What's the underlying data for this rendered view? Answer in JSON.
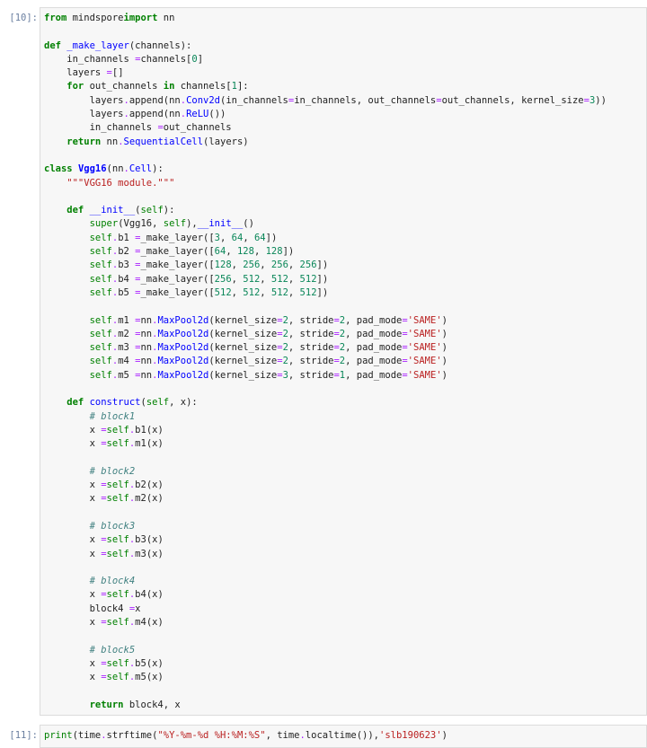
{
  "cells": [
    {
      "prompt": "[10]:",
      "lines": [
        [
          [
            "kw",
            "from"
          ],
          [
            "",
            "mindspore"
          ],
          [
            "kw",
            "import"
          ],
          [
            "",
            "nn"
          ]
        ],
        [],
        [
          [
            "kw",
            "def"
          ],
          [
            "fn",
            "_make_layer"
          ],
          [
            "",
            "(channels):"
          ]
        ],
        [
          [
            "",
            "    in_channels "
          ],
          [
            "op",
            "="
          ],
          [
            "",
            "channels["
          ],
          [
            "num",
            "0"
          ],
          [
            "",
            "]"
          ]
        ],
        [
          [
            "",
            "    layers "
          ],
          [
            "op",
            "="
          ],
          [
            "",
            "[]"
          ]
        ],
        [
          [
            "kw",
            "    for"
          ],
          [
            "",
            "out_channels "
          ],
          [
            "kw",
            "in"
          ],
          [
            "",
            "channels["
          ],
          [
            "num",
            "1"
          ],
          [
            "",
            "]:"
          ]
        ],
        [
          [
            "",
            "        layers"
          ],
          [
            "op",
            "."
          ],
          [
            "",
            "append(nn"
          ],
          [
            "op",
            "."
          ],
          [
            "fn",
            "Conv2d"
          ],
          [
            "",
            "(in_channels"
          ],
          [
            "op",
            "="
          ],
          [
            "",
            "in_channels, out_channels"
          ],
          [
            "op",
            "="
          ],
          [
            "",
            "out_channels, kernel_size"
          ],
          [
            "op",
            "="
          ],
          [
            "num",
            "3"
          ],
          [
            "",
            "))"
          ]
        ],
        [
          [
            "",
            "        layers"
          ],
          [
            "op",
            "."
          ],
          [
            "",
            "append(nn"
          ],
          [
            "op",
            "."
          ],
          [
            "fn",
            "ReLU"
          ],
          [
            "",
            "())"
          ]
        ],
        [
          [
            "",
            "        in_channels "
          ],
          [
            "op",
            "="
          ],
          [
            "",
            "out_channels"
          ]
        ],
        [
          [
            "kw",
            "    return"
          ],
          [
            "",
            "nn"
          ],
          [
            "op",
            "."
          ],
          [
            "fn",
            "SequentialCell"
          ],
          [
            "",
            "(layers)"
          ]
        ],
        [],
        [
          [
            "kw",
            "class"
          ],
          [
            "cls",
            "Vgg16"
          ],
          [
            "",
            "(nn"
          ],
          [
            "op",
            "."
          ],
          [
            "fn",
            "Cell"
          ],
          [
            "",
            "):"
          ]
        ],
        [
          [
            "str",
            "    \"\"\"VGG16 module.\"\"\""
          ]
        ],
        [],
        [
          [
            "kw",
            "    def"
          ],
          [
            "fn",
            "__init__"
          ],
          [
            "",
            "("
          ],
          [
            "self",
            "self"
          ],
          [
            "",
            "):"
          ]
        ],
        [
          [
            "builtin",
            "        super"
          ],
          [
            "",
            "(Vgg16, "
          ],
          [
            "self",
            "self"
          ],
          [
            "",
            "),"
          ],
          [
            "fn",
            "__init__"
          ],
          [
            "",
            "()"
          ]
        ],
        [
          [
            "self",
            "        self"
          ],
          [
            "op",
            "."
          ],
          [
            "",
            "b1 "
          ],
          [
            "op",
            "="
          ],
          [
            "",
            "_make_layer(["
          ],
          [
            "num",
            "3"
          ],
          [
            "",
            ", "
          ],
          [
            "num",
            "64"
          ],
          [
            "",
            ", "
          ],
          [
            "num",
            "64"
          ],
          [
            "",
            "])"
          ]
        ],
        [
          [
            "self",
            "        self"
          ],
          [
            "op",
            "."
          ],
          [
            "",
            "b2 "
          ],
          [
            "op",
            "="
          ],
          [
            "",
            "_make_layer(["
          ],
          [
            "num",
            "64"
          ],
          [
            "",
            ", "
          ],
          [
            "num",
            "128"
          ],
          [
            "",
            ", "
          ],
          [
            "num",
            "128"
          ],
          [
            "",
            "])"
          ]
        ],
        [
          [
            "self",
            "        self"
          ],
          [
            "op",
            "."
          ],
          [
            "",
            "b3 "
          ],
          [
            "op",
            "="
          ],
          [
            "",
            "_make_layer(["
          ],
          [
            "num",
            "128"
          ],
          [
            "",
            ", "
          ],
          [
            "num",
            "256"
          ],
          [
            "",
            ", "
          ],
          [
            "num",
            "256"
          ],
          [
            "",
            ", "
          ],
          [
            "num",
            "256"
          ],
          [
            "",
            "])"
          ]
        ],
        [
          [
            "self",
            "        self"
          ],
          [
            "op",
            "."
          ],
          [
            "",
            "b4 "
          ],
          [
            "op",
            "="
          ],
          [
            "",
            "_make_layer(["
          ],
          [
            "num",
            "256"
          ],
          [
            "",
            ", "
          ],
          [
            "num",
            "512"
          ],
          [
            "",
            ", "
          ],
          [
            "num",
            "512"
          ],
          [
            "",
            ", "
          ],
          [
            "num",
            "512"
          ],
          [
            "",
            "])"
          ]
        ],
        [
          [
            "self",
            "        self"
          ],
          [
            "op",
            "."
          ],
          [
            "",
            "b5 "
          ],
          [
            "op",
            "="
          ],
          [
            "",
            "_make_layer(["
          ],
          [
            "num",
            "512"
          ],
          [
            "",
            ", "
          ],
          [
            "num",
            "512"
          ],
          [
            "",
            ", "
          ],
          [
            "num",
            "512"
          ],
          [
            "",
            ", "
          ],
          [
            "num",
            "512"
          ],
          [
            "",
            "])"
          ]
        ],
        [],
        [
          [
            "self",
            "        self"
          ],
          [
            "op",
            "."
          ],
          [
            "",
            "m1 "
          ],
          [
            "op",
            "="
          ],
          [
            "",
            "nn"
          ],
          [
            "op",
            "."
          ],
          [
            "fn",
            "MaxPool2d"
          ],
          [
            "",
            "(kernel_size"
          ],
          [
            "op",
            "="
          ],
          [
            "num",
            "2"
          ],
          [
            "",
            ", stride"
          ],
          [
            "op",
            "="
          ],
          [
            "num",
            "2"
          ],
          [
            "",
            ", pad_mode"
          ],
          [
            "op",
            "="
          ],
          [
            "str",
            "'SAME'"
          ],
          [
            "",
            ")"
          ]
        ],
        [
          [
            "self",
            "        self"
          ],
          [
            "op",
            "."
          ],
          [
            "",
            "m2 "
          ],
          [
            "op",
            "="
          ],
          [
            "",
            "nn"
          ],
          [
            "op",
            "."
          ],
          [
            "fn",
            "MaxPool2d"
          ],
          [
            "",
            "(kernel_size"
          ],
          [
            "op",
            "="
          ],
          [
            "num",
            "2"
          ],
          [
            "",
            ", stride"
          ],
          [
            "op",
            "="
          ],
          [
            "num",
            "2"
          ],
          [
            "",
            ", pad_mode"
          ],
          [
            "op",
            "="
          ],
          [
            "str",
            "'SAME'"
          ],
          [
            "",
            ")"
          ]
        ],
        [
          [
            "self",
            "        self"
          ],
          [
            "op",
            "."
          ],
          [
            "",
            "m3 "
          ],
          [
            "op",
            "="
          ],
          [
            "",
            "nn"
          ],
          [
            "op",
            "."
          ],
          [
            "fn",
            "MaxPool2d"
          ],
          [
            "",
            "(kernel_size"
          ],
          [
            "op",
            "="
          ],
          [
            "num",
            "2"
          ],
          [
            "",
            ", stride"
          ],
          [
            "op",
            "="
          ],
          [
            "num",
            "2"
          ],
          [
            "",
            ", pad_mode"
          ],
          [
            "op",
            "="
          ],
          [
            "str",
            "'SAME'"
          ],
          [
            "",
            ")"
          ]
        ],
        [
          [
            "self",
            "        self"
          ],
          [
            "op",
            "."
          ],
          [
            "",
            "m4 "
          ],
          [
            "op",
            "="
          ],
          [
            "",
            "nn"
          ],
          [
            "op",
            "."
          ],
          [
            "fn",
            "MaxPool2d"
          ],
          [
            "",
            "(kernel_size"
          ],
          [
            "op",
            "="
          ],
          [
            "num",
            "2"
          ],
          [
            "",
            ", stride"
          ],
          [
            "op",
            "="
          ],
          [
            "num",
            "2"
          ],
          [
            "",
            ", pad_mode"
          ],
          [
            "op",
            "="
          ],
          [
            "str",
            "'SAME'"
          ],
          [
            "",
            ")"
          ]
        ],
        [
          [
            "self",
            "        self"
          ],
          [
            "op",
            "."
          ],
          [
            "",
            "m5 "
          ],
          [
            "op",
            "="
          ],
          [
            "",
            "nn"
          ],
          [
            "op",
            "."
          ],
          [
            "fn",
            "MaxPool2d"
          ],
          [
            "",
            "(kernel_size"
          ],
          [
            "op",
            "="
          ],
          [
            "num",
            "3"
          ],
          [
            "",
            ", stride"
          ],
          [
            "op",
            "="
          ],
          [
            "num",
            "1"
          ],
          [
            "",
            ", pad_mode"
          ],
          [
            "op",
            "="
          ],
          [
            "str",
            "'SAME'"
          ],
          [
            "",
            ")"
          ]
        ],
        [],
        [
          [
            "kw",
            "    def"
          ],
          [
            "fn",
            "construct"
          ],
          [
            "",
            "("
          ],
          [
            "self",
            "self"
          ],
          [
            "",
            ", x):"
          ]
        ],
        [
          [
            "cm",
            "        # block1"
          ]
        ],
        [
          [
            "",
            "        x "
          ],
          [
            "op",
            "="
          ],
          [
            "self",
            "self"
          ],
          [
            "op",
            "."
          ],
          [
            "",
            "b1(x)"
          ]
        ],
        [
          [
            "",
            "        x "
          ],
          [
            "op",
            "="
          ],
          [
            "self",
            "self"
          ],
          [
            "op",
            "."
          ],
          [
            "",
            "m1(x)"
          ]
        ],
        [],
        [
          [
            "cm",
            "        # block2"
          ]
        ],
        [
          [
            "",
            "        x "
          ],
          [
            "op",
            "="
          ],
          [
            "self",
            "self"
          ],
          [
            "op",
            "."
          ],
          [
            "",
            "b2(x)"
          ]
        ],
        [
          [
            "",
            "        x "
          ],
          [
            "op",
            "="
          ],
          [
            "self",
            "self"
          ],
          [
            "op",
            "."
          ],
          [
            "",
            "m2(x)"
          ]
        ],
        [],
        [
          [
            "cm",
            "        # block3"
          ]
        ],
        [
          [
            "",
            "        x "
          ],
          [
            "op",
            "="
          ],
          [
            "self",
            "self"
          ],
          [
            "op",
            "."
          ],
          [
            "",
            "b3(x)"
          ]
        ],
        [
          [
            "",
            "        x "
          ],
          [
            "op",
            "="
          ],
          [
            "self",
            "self"
          ],
          [
            "op",
            "."
          ],
          [
            "",
            "m3(x)"
          ]
        ],
        [],
        [
          [
            "cm",
            "        # block4"
          ]
        ],
        [
          [
            "",
            "        x "
          ],
          [
            "op",
            "="
          ],
          [
            "self",
            "self"
          ],
          [
            "op",
            "."
          ],
          [
            "",
            "b4(x)"
          ]
        ],
        [
          [
            "",
            "        block4 "
          ],
          [
            "op",
            "="
          ],
          [
            "",
            "x"
          ]
        ],
        [
          [
            "",
            "        x "
          ],
          [
            "op",
            "="
          ],
          [
            "self",
            "self"
          ],
          [
            "op",
            "."
          ],
          [
            "",
            "m4(x)"
          ]
        ],
        [],
        [
          [
            "cm",
            "        # block5"
          ]
        ],
        [
          [
            "",
            "        x "
          ],
          [
            "op",
            "="
          ],
          [
            "self",
            "self"
          ],
          [
            "op",
            "."
          ],
          [
            "",
            "b5(x)"
          ]
        ],
        [
          [
            "",
            "        x "
          ],
          [
            "op",
            "="
          ],
          [
            "self",
            "self"
          ],
          [
            "op",
            "."
          ],
          [
            "",
            "m5(x)"
          ]
        ],
        [],
        [
          [
            "kw",
            "        return"
          ],
          [
            "",
            "block4, x"
          ]
        ]
      ]
    },
    {
      "prompt": "[11]:",
      "lines": [
        [
          [
            "builtin",
            "print"
          ],
          [
            "",
            "(time"
          ],
          [
            "op",
            "."
          ],
          [
            "",
            "strftime("
          ],
          [
            "str",
            "\"%Y-%m-%d %H:%M:%S\""
          ],
          [
            "",
            ", time"
          ],
          [
            "op",
            "."
          ],
          [
            "",
            "localtime()),"
          ],
          [
            "str",
            "'slb190623'"
          ],
          [
            "",
            ")"
          ]
        ]
      ]
    }
  ]
}
